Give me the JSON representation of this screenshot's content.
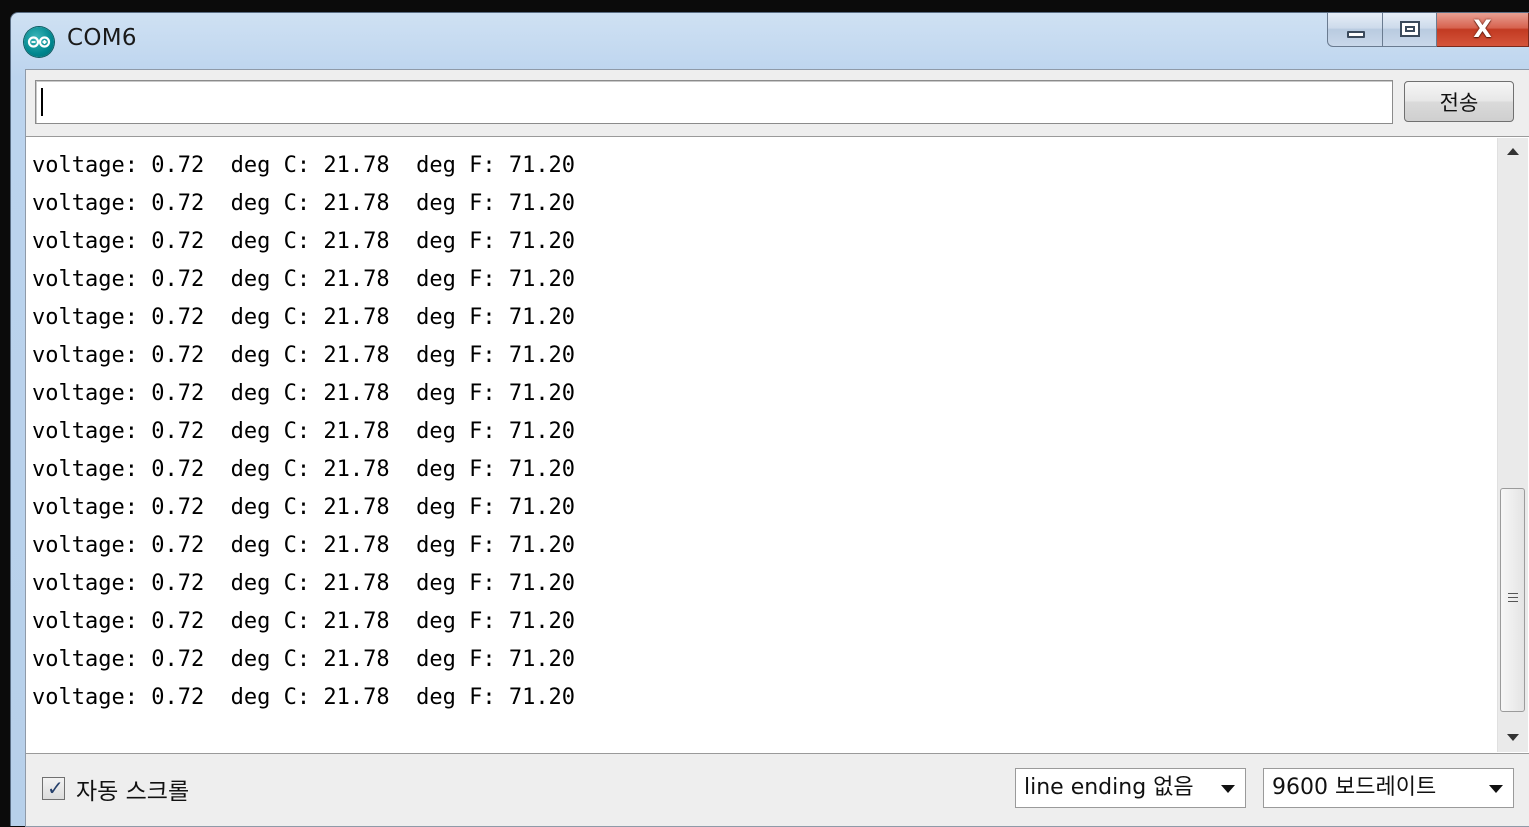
{
  "window": {
    "title": "COM6",
    "icon": "arduino-icon",
    "close_glyph": "X"
  },
  "send": {
    "input_value": "",
    "button_label": "전송"
  },
  "output": {
    "lines": [
      "voltage: 0.72  deg C: 21.78  deg F: 71.20",
      "voltage: 0.72  deg C: 21.78  deg F: 71.20",
      "voltage: 0.72  deg C: 21.78  deg F: 71.20",
      "voltage: 0.72  deg C: 21.78  deg F: 71.20",
      "voltage: 0.72  deg C: 21.78  deg F: 71.20",
      "voltage: 0.72  deg C: 21.78  deg F: 71.20",
      "voltage: 0.72  deg C: 21.78  deg F: 71.20",
      "voltage: 0.72  deg C: 21.78  deg F: 71.20",
      "voltage: 0.72  deg C: 21.78  deg F: 71.20",
      "voltage: 0.72  deg C: 21.78  deg F: 71.20",
      "voltage: 0.72  deg C: 21.78  deg F: 71.20",
      "voltage: 0.72  deg C: 21.78  deg F: 71.20",
      "voltage: 0.72  deg C: 21.78  deg F: 71.20",
      "voltage: 0.72  deg C: 21.78  deg F: 71.20",
      "voltage: 0.72  deg C: 21.78  deg F: 71.20"
    ]
  },
  "footer": {
    "autoscroll_label": "자동 스크롤",
    "autoscroll_checked": true,
    "line_ending_selected": "line ending 없음",
    "baud_selected": "9600 보드레이트"
  },
  "colors": {
    "accent_close": "#c23a22",
    "app_icon": "#00878f"
  }
}
